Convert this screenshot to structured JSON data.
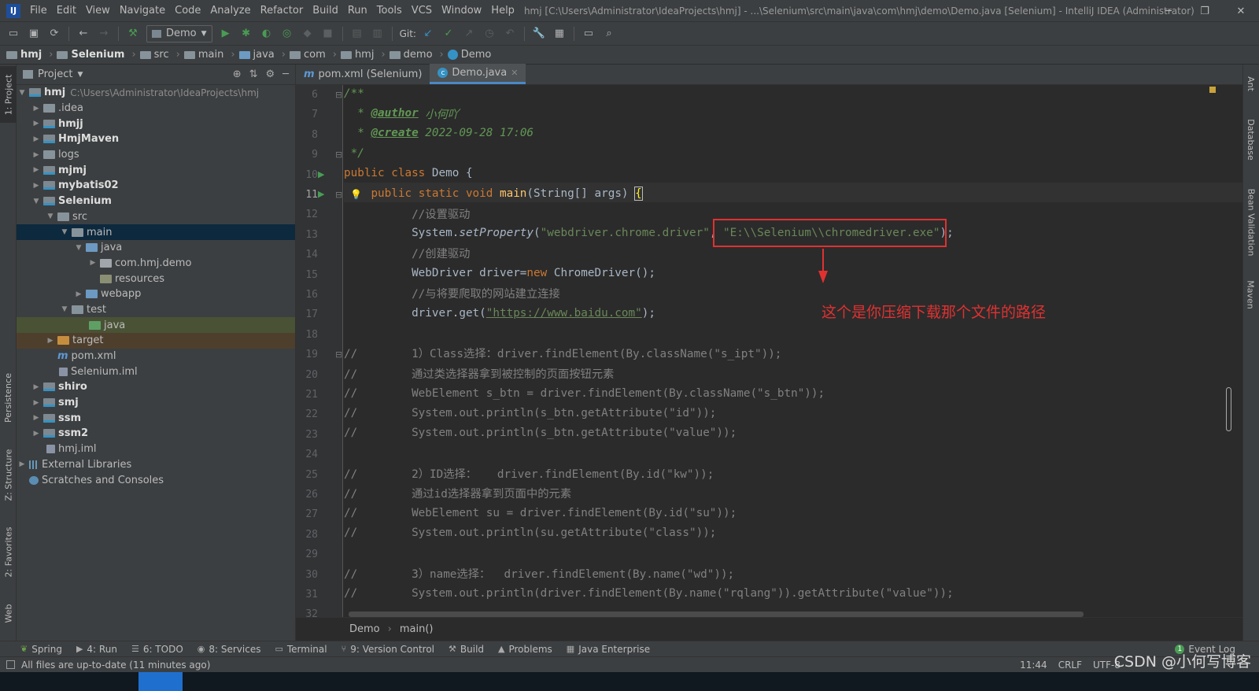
{
  "menubar": {
    "items": [
      "File",
      "Edit",
      "View",
      "Navigate",
      "Code",
      "Analyze",
      "Refactor",
      "Build",
      "Run",
      "Tools",
      "VCS",
      "Window",
      "Help"
    ],
    "window_title": "hmj [C:\\Users\\Administrator\\IdeaProjects\\hmj] - ...\\Selenium\\src\\main\\java\\com\\hmj\\demo\\Demo.java [Selenium] - IntelliJ IDEA (Administrator)"
  },
  "toolbar": {
    "run_config": "Demo",
    "git_label": "Git:"
  },
  "breadcrumbs": [
    "hmj",
    "Selenium",
    "src",
    "main",
    "java",
    "com",
    "hmj",
    "demo",
    "Demo"
  ],
  "project": {
    "title": "Project",
    "tree": [
      {
        "label": "hmj",
        "path": "C:\\Users\\Administrator\\IdeaProjects\\hmj"
      },
      {
        "label": ".idea"
      },
      {
        "label": "hmjj"
      },
      {
        "label": "HmjMaven"
      },
      {
        "label": "logs"
      },
      {
        "label": "mjmj"
      },
      {
        "label": "mybatis02"
      },
      {
        "label": "Selenium"
      },
      {
        "label": "src"
      },
      {
        "label": "main"
      },
      {
        "label": "java"
      },
      {
        "label": "com.hmj.demo"
      },
      {
        "label": "resources"
      },
      {
        "label": "webapp"
      },
      {
        "label": "test"
      },
      {
        "label": "java"
      },
      {
        "label": "target"
      },
      {
        "label": "pom.xml"
      },
      {
        "label": "Selenium.iml"
      },
      {
        "label": "shiro"
      },
      {
        "label": "smj"
      },
      {
        "label": "ssm"
      },
      {
        "label": "ssm2"
      },
      {
        "label": "hmj.iml"
      },
      {
        "label": "External Libraries"
      },
      {
        "label": "Scratches and Consoles"
      }
    ]
  },
  "left_tool_tabs": [
    "1: Project",
    "Persistence",
    "Z: Structure",
    "2: Favorites",
    "Web"
  ],
  "right_tool_tabs": [
    "Ant",
    "Database",
    "Bean Validation",
    "Maven"
  ],
  "editor": {
    "tabs": [
      {
        "label": "pom.xml (Selenium)"
      },
      {
        "label": "Demo.java"
      }
    ],
    "lines": [
      6,
      7,
      8,
      9,
      10,
      11,
      12,
      13,
      14,
      15,
      16,
      17,
      18,
      19,
      20,
      21,
      22,
      23,
      24,
      25,
      26,
      27,
      28,
      29,
      30,
      31,
      32
    ],
    "code": {
      "l6": "/**",
      "l7_tag": "@author",
      "l7_val": " 小何吖",
      "l8_tag": "@create",
      "l8_val": " 2022-09-28 17:06",
      "l9": " */",
      "l10_kw": "public class",
      "l10_rest": " Demo {",
      "l11_kw": "public static void",
      "l11_m": "main",
      "l11_rest": "(String[] args) ",
      "l11_brace": "{",
      "l12": "//设置驱动",
      "l13_a": "System.",
      "l13_m": "setProperty",
      "l13_b": "(",
      "l13_s1": "\"webdriver.chrome.driver\"",
      "l13_c": ", ",
      "l13_s2": "\"E:\\\\Selenium\\\\chromedriver.exe\"",
      "l13_d": ");",
      "l14": "//创建驱动",
      "l15_a": "WebDriver driver=",
      "l15_kw": "new",
      "l15_b": " ChromeDriver();",
      "l16": "//与将要爬取的网站建立连接",
      "l17_a": "driver.get(",
      "l17_s": "\"https://www.baidu.com\"",
      "l17_b": ");",
      "l19": "//        1）Class选择：driver.findElement(By.className(\"s_ipt\"));",
      "l20": "//        通过类选择器拿到被控制的页面按钮元素",
      "l21": "//        WebElement s_btn = driver.findElement(By.className(\"s_btn\"));",
      "l22": "//        System.out.println(s_btn.getAttribute(\"id\"));",
      "l23": "//        System.out.println(s_btn.getAttribute(\"value\"));",
      "l25": "//        2）ID选择：   driver.findElement(By.id(\"kw\"));",
      "l26": "//        通过id选择器拿到页面中的元素",
      "l27": "//        WebElement su = driver.findElement(By.id(\"su\"));",
      "l28": "//        System.out.println(su.getAttribute(\"class\"));",
      "l30": "//        3）name选择：  driver.findElement(By.name(\"wd\"));",
      "l31": "//        System.out.println(driver.findElement(By.name(\"rqlang\")).getAttribute(\"value\"));"
    },
    "annotation": "这个是你压缩下载那个文件的路径",
    "breadcrumb": [
      "Demo",
      "main()"
    ]
  },
  "tool_tabs": [
    {
      "icon": "spring",
      "label": "Spring"
    },
    {
      "icon": "run",
      "label": "4: Run"
    },
    {
      "icon": "todo",
      "label": "6: TODO"
    },
    {
      "icon": "services",
      "label": "8: Services"
    },
    {
      "icon": "terminal",
      "label": "Terminal"
    },
    {
      "icon": "vcs",
      "label": "9: Version Control"
    },
    {
      "icon": "build",
      "label": "Build"
    },
    {
      "icon": "problems",
      "label": "Problems"
    },
    {
      "icon": "javaee",
      "label": "Java Enterprise"
    }
  ],
  "event_log": "Event Log",
  "status": {
    "message": "All files are up-to-date (11 minutes ago)",
    "position": "11:44",
    "line_sep": "CRLF",
    "encoding": "UTF-8"
  },
  "watermark": "CSDN @小何写博客",
  "colors": {
    "accent": "#4a88c7",
    "annotation": "#e03131",
    "selection": "#0d293e"
  }
}
